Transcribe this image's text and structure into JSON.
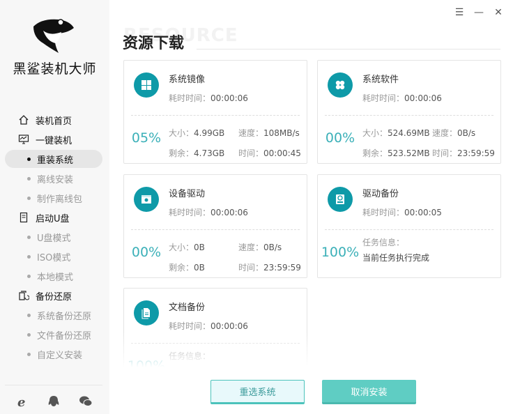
{
  "app": {
    "brand": "黑鲨装机大师",
    "logo_icon": "shark-logo-icon"
  },
  "window_controls": {
    "menu": "☰",
    "minimize": "—",
    "close": "✕"
  },
  "sidebar": {
    "items": [
      {
        "label": "装机首页",
        "type": "head",
        "icon": "home-icon"
      },
      {
        "label": "一键装机",
        "type": "head",
        "icon": "monitor-icon"
      },
      {
        "label": "重装系统",
        "type": "sub",
        "active": true
      },
      {
        "label": "离线安装",
        "type": "sub"
      },
      {
        "label": "制作离线包",
        "type": "sub"
      },
      {
        "label": "启动U盘",
        "type": "head",
        "icon": "usb-icon"
      },
      {
        "label": "U盘模式",
        "type": "sub"
      },
      {
        "label": "ISO模式",
        "type": "sub"
      },
      {
        "label": "本地模式",
        "type": "sub"
      },
      {
        "label": "备份还原",
        "type": "head",
        "icon": "backup-icon"
      },
      {
        "label": "系统备份还原",
        "type": "sub"
      },
      {
        "label": "文件备份还原",
        "type": "sub"
      },
      {
        "label": "自定义安装",
        "type": "sub"
      }
    ],
    "footer_icons": [
      "ie-icon",
      "qq-icon",
      "wechat-icon"
    ]
  },
  "main": {
    "watermark": "RESOURCE",
    "title": "资源下载",
    "cards": [
      {
        "name": "系统镜像",
        "elapsed_label": "耗时时间：",
        "elapsed": "00:00:06",
        "percent": "05%",
        "size_label": "大小：",
        "size": "4.99GB",
        "speed_label": "速度：",
        "speed": "108MB/s",
        "remain_label": "剩余：",
        "remain": "4.73GB",
        "time_label": "时间：",
        "time": "00:00:45",
        "icon": "windows-icon"
      },
      {
        "name": "系统软件",
        "elapsed_label": "耗时时间：",
        "elapsed": "00:00:06",
        "percent": "00%",
        "size_label": "大小：",
        "size": "524.69MB",
        "speed_label": "速度：",
        "speed": "0B/s",
        "remain_label": "剩余：",
        "remain": "523.52MB",
        "time_label": "时间：",
        "time": "23:59:59",
        "icon": "apps-icon"
      },
      {
        "name": "设备驱动",
        "elapsed_label": "耗时时间：",
        "elapsed": "00:00:06",
        "percent": "00%",
        "size_label": "大小：",
        "size": "0B",
        "speed_label": "速度：",
        "speed": "0B/s",
        "remain_label": "剩余：",
        "remain": "0B",
        "time_label": "时间：",
        "time": "23:59:59",
        "icon": "driver-icon"
      },
      {
        "name": "驱动备份",
        "elapsed_label": "耗时时间：",
        "elapsed": "00:00:05",
        "percent": "100%",
        "info_label": "任务信息：",
        "info": "当前任务执行完成",
        "icon": "disk-icon"
      },
      {
        "name": "文档备份",
        "elapsed_label": "耗时时间：",
        "elapsed": "00:00:06",
        "percent": "100%",
        "info_label": "任务信息：",
        "icon": "document-icon"
      }
    ]
  },
  "buttons": {
    "reselect": "重选系统",
    "cancel": "取消安装"
  },
  "colors": {
    "accent": "#0e9aa8",
    "percent": "#3bb0b8",
    "cancel_bg": "#5fcdc3"
  }
}
